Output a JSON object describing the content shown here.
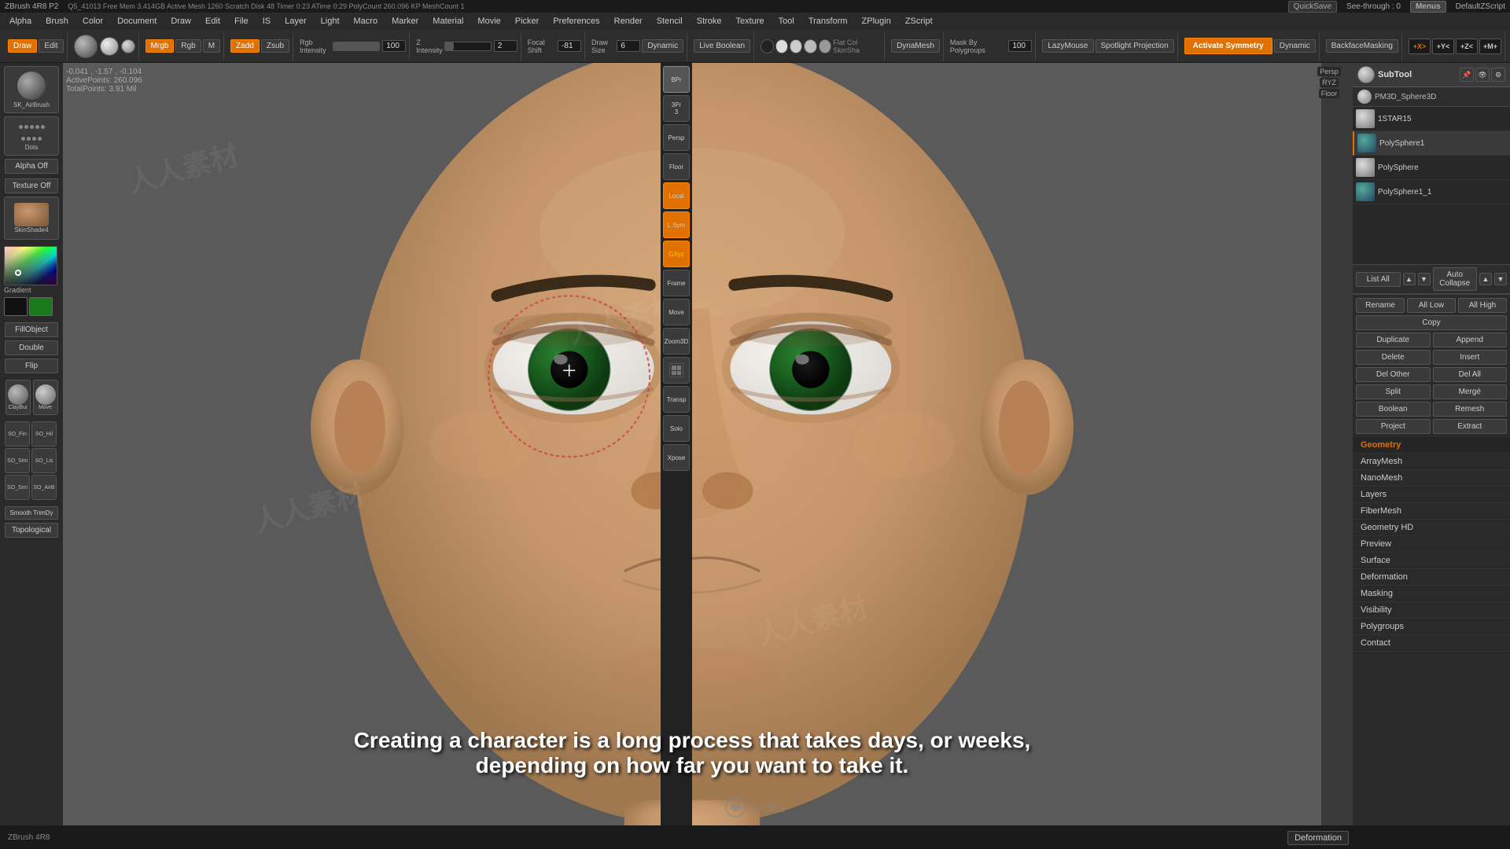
{
  "app": {
    "title": "ZBrush 4R8 P2",
    "version_info": "Q5_41013   Free Mem 3.414GB  Active Mesh 1260  Scratch Disk 48  Timer 0:23   ATime 0:29   PolyCount 260.096  KP  MeshCount 1"
  },
  "top_bar": {
    "items": [
      "ZBrush 4R8 P2",
      "Q5_41013",
      "Free Mem 3.414GB",
      "Active Mesh 1260",
      "Scratch Disk 48",
      "Timer►0:23",
      "ATime►0:29",
      "PolyCount►260.096",
      "KP",
      "MeshCount►1"
    ],
    "quicksave": "QuickSave",
    "see_through": "See-through : 0",
    "menus": "Menus",
    "defaultzscript": "DefaultZScript"
  },
  "menu_bar": {
    "items": [
      "Alpha",
      "Brush",
      "Color",
      "Document",
      "Draw",
      "Edit",
      "File",
      "IS",
      "Layer",
      "Light",
      "Macro",
      "Marker",
      "Material",
      "Movie",
      "Picker",
      "Preferences",
      "Render",
      "Stencil",
      "Stroke",
      "Texture",
      "Tool",
      "Transform",
      "ZPlugin",
      "ZScript"
    ]
  },
  "toolbar": {
    "draw_btn": "Draw",
    "mrgb_btn": "Mrgb",
    "rgb_btn": "Rgb",
    "m_btn": "M",
    "zadd_btn": "Zadd",
    "zsub_btn": "Zsub",
    "rgb_intensity_label": "Rgb Intensity",
    "rgb_intensity_value": "100",
    "z_intensity_label": "Z Intensity",
    "z_intensity_value": "2",
    "focal_shift_label": "Focal Shift",
    "focal_shift_value": "-81",
    "draw_size_label": "Draw Size",
    "draw_size_value": "6",
    "dynamic_label": "Dynamic",
    "live_boolean_label": "Live Boolean",
    "lazy_mouse_label": "LazyMouse",
    "mask_by_polygroups_label": "Mask By Polygroups",
    "mask_by_polygroups_value": "100",
    "spotlight_projection_label": "Spotlight Projection",
    "activate_symmetry_label": "Activate Symmetry",
    "dynamic_label2": "Dynamic",
    "backface_masking_label": "BackfaceMasking",
    "sym_x": "+X>",
    "sym_y": "+Y<",
    "sym_z": "+Z<",
    "sym_m": "+M+"
  },
  "brush_icons": {
    "airbrush_label": "SK_AirBrush",
    "dots_label": "Dots",
    "alpha_off_label": "Alpha Off",
    "texture_off_label": "Texture Off",
    "skinshaded_label": "SkinShade4",
    "gradient_label": "Gradient",
    "fillobj_label": "FillObject",
    "double_label": "Double",
    "flip_label": "Flip",
    "claybui_label": "ClayBui",
    "move_label": "Move",
    "smooth_trimdry_label": "Smooth TrimDy",
    "topological_label": "Topological"
  },
  "left_brushes": [
    {
      "name": "SO_Fine",
      "label": "SO_Fin SO_Hil"
    },
    {
      "name": "SO_Smooth",
      "label": "SO_Smi SO_Lis"
    },
    {
      "name": "SO_Smooth2",
      "label": "SO_Smi SO_AirB"
    }
  ],
  "viewport": {
    "coords": "-0.041 , -1.57 , -0.104",
    "active_points": "ActivePoints: 260.096",
    "total_points": "TotalPoints: 3.91 Mil"
  },
  "subtool_panel": {
    "title": "SubTool",
    "model_name": "PM3D_Sphere3D",
    "view_labels": [
      "Persp",
      "RYZ",
      "Floor"
    ],
    "items": [
      {
        "name": "1STAR15",
        "type": "sphere"
      },
      {
        "name": "PolySphere1",
        "type": "sphere"
      },
      {
        "name": "PolySphere",
        "type": "sphere"
      },
      {
        "name": "PolySphere1_1",
        "type": "sphere"
      }
    ],
    "list_all_label": "List All",
    "auto_collapse_label": "Auto Collapse",
    "rename_label": "Rename",
    "all_low_label": "All Low",
    "all_high_label": "All High",
    "copy_label": "Copy",
    "duplicate_label": "Duplicate",
    "append_label": "Append",
    "delete_label": "Delete",
    "insert_label": "Insert",
    "del_other_label": "Del Other",
    "del_all_label": "Del All",
    "split_label": "Split",
    "merge_label": "Mergé",
    "boolean_label": "Boolean",
    "remesh_label": "Remesh",
    "project_label": "Project",
    "extract_label": "Extract"
  },
  "right_menu": {
    "items": [
      {
        "label": "Geometry",
        "type": "section"
      },
      {
        "label": "ArrayMesh",
        "type": "item"
      },
      {
        "label": "NanoMesh",
        "type": "item"
      },
      {
        "label": "Layers",
        "type": "item"
      },
      {
        "label": "FiberMesh",
        "type": "item"
      },
      {
        "label": "Geometry HD",
        "type": "item"
      },
      {
        "label": "Preview",
        "type": "item"
      },
      {
        "label": "Surface",
        "type": "item"
      },
      {
        "label": "Deformation",
        "type": "item"
      },
      {
        "label": "Masking",
        "type": "item"
      },
      {
        "label": "Visibility",
        "type": "item"
      },
      {
        "label": "Polygroups",
        "type": "item"
      },
      {
        "label": "Contact",
        "type": "item"
      }
    ]
  },
  "subtitle": {
    "line1": "Creating a character is a long process that takes days, or weeks,",
    "line2": "depending on how far you want to take it."
  },
  "icons_strip": {
    "buttons": [
      {
        "label": "BPr",
        "name": "bpr-btn"
      },
      {
        "label": "3Pr\n3",
        "name": "3pr-btn"
      },
      {
        "label": "Persp",
        "name": "persp-btn"
      },
      {
        "label": "Floor",
        "name": "floor-btn"
      },
      {
        "label": "Local",
        "name": "local-btn",
        "active": true
      },
      {
        "label": "L.Sym",
        "name": "lsym-btn",
        "active": true
      },
      {
        "label": "GXyz",
        "name": "gxyz-btn",
        "active": true
      },
      {
        "label": "Frame",
        "name": "frame-btn"
      },
      {
        "label": "Move",
        "name": "move-btn"
      },
      {
        "label": "Zoom3D",
        "name": "zoom3d-btn"
      },
      {
        "label": "PolyF",
        "name": "polyf-btn"
      },
      {
        "label": "Transp",
        "name": "transp-btn"
      },
      {
        "label": "Solo",
        "name": "solo-btn"
      },
      {
        "label": "Xpose",
        "name": "xpose-btn"
      }
    ]
  },
  "bottom": {
    "deformation_label": "Deformation"
  },
  "colors": {
    "accent": "#e07000",
    "background": "#2a2a2a",
    "viewport_bg": "#888888",
    "face_skin": "#c4956a"
  }
}
